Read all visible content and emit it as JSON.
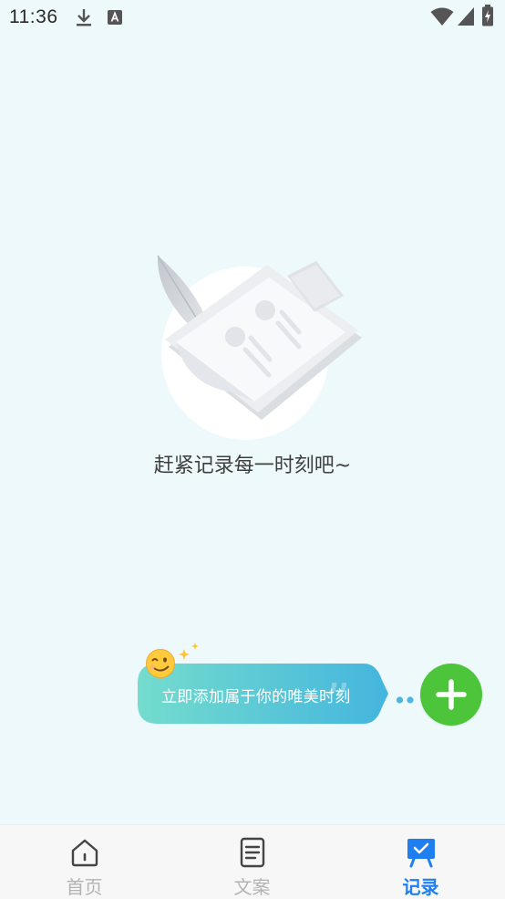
{
  "status_bar": {
    "time": "11:36",
    "icons": [
      "download-icon",
      "keyboard-a-icon",
      "wifi-icon",
      "signal-icon",
      "battery-charging-icon"
    ]
  },
  "empty_state": {
    "illustration": "clipboard-feather-illustration",
    "message": "赶紧记录每一时刻吧~"
  },
  "tip_bubble": {
    "emoji": "winking-face-icon",
    "text": "立即添加属于你的唯美时刻"
  },
  "add_button": {
    "icon": "plus-icon",
    "color": "#4cc53a"
  },
  "tab_bar": {
    "active_color": "#1f7ff0",
    "inactive_color": "#b3b3b3",
    "tabs": [
      {
        "label": "首页",
        "icon": "home-icon",
        "active": false
      },
      {
        "label": "文案",
        "icon": "document-icon",
        "active": false
      },
      {
        "label": "记录",
        "icon": "record-board-icon",
        "active": true
      }
    ]
  }
}
